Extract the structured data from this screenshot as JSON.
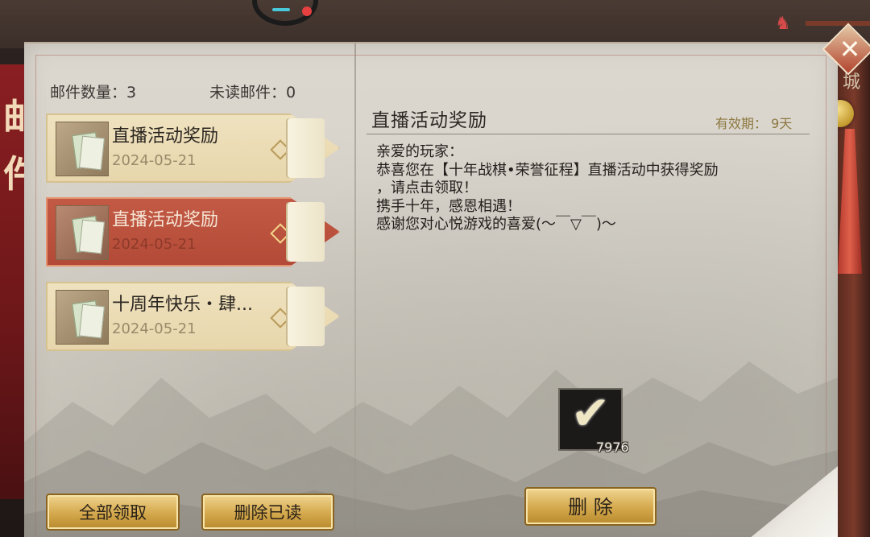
{
  "header": {
    "mail_count_label": "邮件数量：3",
    "unread_label": "未读邮件：0"
  },
  "mail_list": [
    {
      "title": "直播活动奖励",
      "date": "2024-05-21",
      "selected": false
    },
    {
      "title": "直播活动奖励",
      "date": "2024-05-21",
      "selected": true
    },
    {
      "title": "十周年快乐・肆...",
      "date": "2024-05-21",
      "selected": false
    }
  ],
  "detail": {
    "title": "直播活动奖励",
    "validity": "有效期：  9天",
    "body_lines": [
      "亲爱的玩家：",
      "恭喜您在【十年战棋•荣誉征程】直播活动中获得奖励",
      "，请点击领取！",
      "携手十年，感恩相遇！",
      "感谢您对心悦游戏的喜爱(～￣▽￣)～"
    ],
    "reward": {
      "icon": "check-icon",
      "count": "7976"
    }
  },
  "buttons": {
    "claim_all": "全部领取",
    "delete_read": "删除已读",
    "delete": "删  除"
  },
  "decor": {
    "banner_glyph_top": "邮",
    "banner_glyph_bottom": "件",
    "right_peek": "城",
    "close_symbol": "✕",
    "bat_symbol": "♞"
  },
  "colors": {
    "accent_red": "#b24a37",
    "gold": "#d4a84c",
    "paper": "#d3cfc6"
  }
}
